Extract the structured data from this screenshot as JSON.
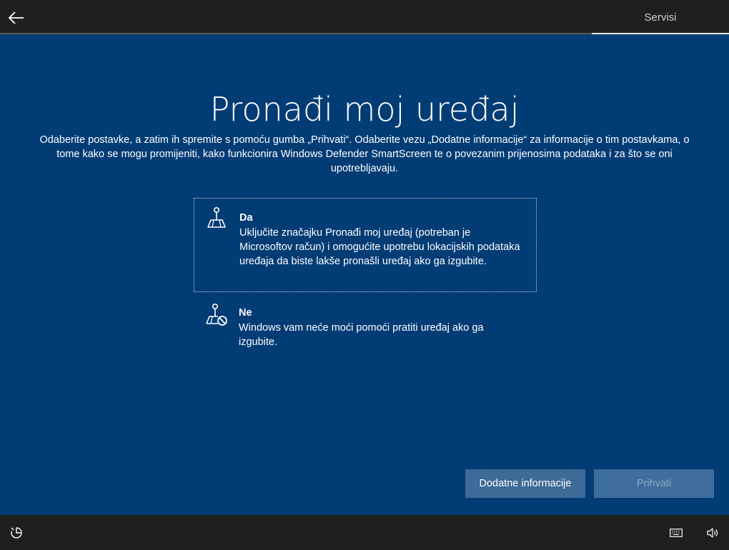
{
  "header": {
    "tab_label": "Servisi"
  },
  "main": {
    "title": "Pronađi moj uređaj",
    "description": "Odaberite postavke, a zatim ih spremite s pomoću gumba „Prihvati“. Odaberite vezu „Dodatne informacije“ za informacije o tim postavkama, o tome kako se mogu promijeniti, kako funkcionira Windows Defender SmartScreen te o povezanim prijenosima podataka i za što se oni upotrebljavaju.",
    "options": [
      {
        "title": "Da",
        "body": "Uključite značajku Pronađi moj uređaj (potreban je Microsoftov račun) i omogućite upotrebu lokacijskih podataka uređaja da biste lakše pronašli uređaj ako ga izgubite.",
        "icon": "map-pin-icon",
        "selected": true
      },
      {
        "title": "Ne",
        "body": "Windows vam neće moći pomoći pratiti uređaj ako ga izgubite.",
        "icon": "map-pin-blocked-icon",
        "selected": false
      }
    ],
    "buttons": {
      "more_info": "Dodatne informacije",
      "accept": "Prihvati"
    }
  },
  "footer": {
    "icons": [
      "ease-of-access-icon",
      "keyboard-icon",
      "volume-icon"
    ]
  },
  "colors": {
    "background": "#013c75",
    "bar": "#1f1f1f",
    "button": "#3d6a96"
  }
}
